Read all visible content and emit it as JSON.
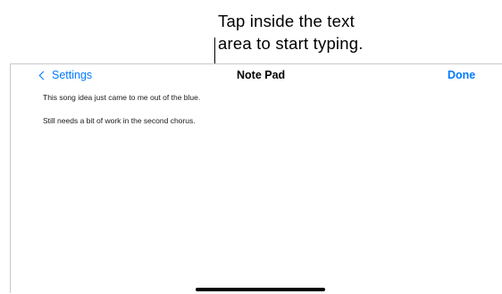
{
  "callout": {
    "line1": "Tap inside the text",
    "line2": "area to start typing."
  },
  "navbar": {
    "back_label": "Settings",
    "title": "Note Pad",
    "done_label": "Done"
  },
  "note": {
    "lines": [
      "This song idea just came to me out of the blue.",
      "Still needs a bit of work in the second chorus."
    ]
  },
  "icons": {
    "back": "chevron-left-icon"
  },
  "colors": {
    "accent": "#007aff"
  }
}
